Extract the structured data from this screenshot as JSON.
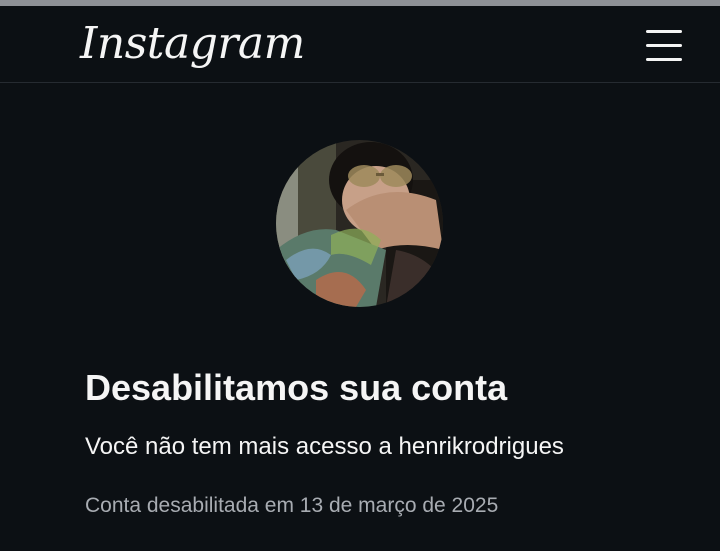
{
  "header": {
    "logo_text": "Instagram",
    "menu_icon": "hamburger-menu-icon"
  },
  "profile": {
    "avatar_icon": "profile-photo"
  },
  "notice": {
    "title": "Desabilitamos sua conta",
    "message": "Você não tem mais acesso a henrikrodrigues",
    "disabled_date": "Conta desabilitada em 13 de março de 2025"
  },
  "colors": {
    "background": "#0c1014",
    "text_primary": "#f5f5f5",
    "text_secondary": "#a8acb2",
    "divider": "#262b31"
  }
}
